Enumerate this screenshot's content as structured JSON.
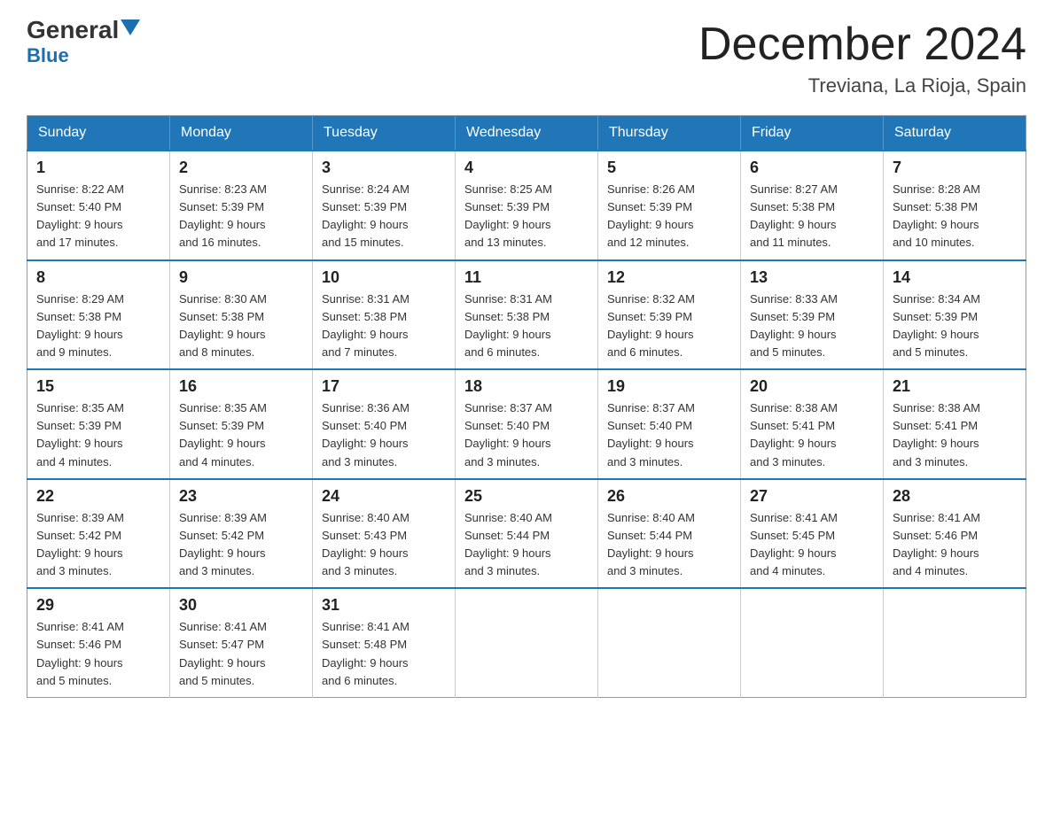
{
  "header": {
    "logo_general": "General",
    "logo_blue": "Blue",
    "title": "December 2024",
    "subtitle": "Treviana, La Rioja, Spain"
  },
  "days_of_week": [
    "Sunday",
    "Monday",
    "Tuesday",
    "Wednesday",
    "Thursday",
    "Friday",
    "Saturday"
  ],
  "weeks": [
    [
      {
        "day": "1",
        "info": "Sunrise: 8:22 AM\nSunset: 5:40 PM\nDaylight: 9 hours\nand 17 minutes."
      },
      {
        "day": "2",
        "info": "Sunrise: 8:23 AM\nSunset: 5:39 PM\nDaylight: 9 hours\nand 16 minutes."
      },
      {
        "day": "3",
        "info": "Sunrise: 8:24 AM\nSunset: 5:39 PM\nDaylight: 9 hours\nand 15 minutes."
      },
      {
        "day": "4",
        "info": "Sunrise: 8:25 AM\nSunset: 5:39 PM\nDaylight: 9 hours\nand 13 minutes."
      },
      {
        "day": "5",
        "info": "Sunrise: 8:26 AM\nSunset: 5:39 PM\nDaylight: 9 hours\nand 12 minutes."
      },
      {
        "day": "6",
        "info": "Sunrise: 8:27 AM\nSunset: 5:38 PM\nDaylight: 9 hours\nand 11 minutes."
      },
      {
        "day": "7",
        "info": "Sunrise: 8:28 AM\nSunset: 5:38 PM\nDaylight: 9 hours\nand 10 minutes."
      }
    ],
    [
      {
        "day": "8",
        "info": "Sunrise: 8:29 AM\nSunset: 5:38 PM\nDaylight: 9 hours\nand 9 minutes."
      },
      {
        "day": "9",
        "info": "Sunrise: 8:30 AM\nSunset: 5:38 PM\nDaylight: 9 hours\nand 8 minutes."
      },
      {
        "day": "10",
        "info": "Sunrise: 8:31 AM\nSunset: 5:38 PM\nDaylight: 9 hours\nand 7 minutes."
      },
      {
        "day": "11",
        "info": "Sunrise: 8:31 AM\nSunset: 5:38 PM\nDaylight: 9 hours\nand 6 minutes."
      },
      {
        "day": "12",
        "info": "Sunrise: 8:32 AM\nSunset: 5:39 PM\nDaylight: 9 hours\nand 6 minutes."
      },
      {
        "day": "13",
        "info": "Sunrise: 8:33 AM\nSunset: 5:39 PM\nDaylight: 9 hours\nand 5 minutes."
      },
      {
        "day": "14",
        "info": "Sunrise: 8:34 AM\nSunset: 5:39 PM\nDaylight: 9 hours\nand 5 minutes."
      }
    ],
    [
      {
        "day": "15",
        "info": "Sunrise: 8:35 AM\nSunset: 5:39 PM\nDaylight: 9 hours\nand 4 minutes."
      },
      {
        "day": "16",
        "info": "Sunrise: 8:35 AM\nSunset: 5:39 PM\nDaylight: 9 hours\nand 4 minutes."
      },
      {
        "day": "17",
        "info": "Sunrise: 8:36 AM\nSunset: 5:40 PM\nDaylight: 9 hours\nand 3 minutes."
      },
      {
        "day": "18",
        "info": "Sunrise: 8:37 AM\nSunset: 5:40 PM\nDaylight: 9 hours\nand 3 minutes."
      },
      {
        "day": "19",
        "info": "Sunrise: 8:37 AM\nSunset: 5:40 PM\nDaylight: 9 hours\nand 3 minutes."
      },
      {
        "day": "20",
        "info": "Sunrise: 8:38 AM\nSunset: 5:41 PM\nDaylight: 9 hours\nand 3 minutes."
      },
      {
        "day": "21",
        "info": "Sunrise: 8:38 AM\nSunset: 5:41 PM\nDaylight: 9 hours\nand 3 minutes."
      }
    ],
    [
      {
        "day": "22",
        "info": "Sunrise: 8:39 AM\nSunset: 5:42 PM\nDaylight: 9 hours\nand 3 minutes."
      },
      {
        "day": "23",
        "info": "Sunrise: 8:39 AM\nSunset: 5:42 PM\nDaylight: 9 hours\nand 3 minutes."
      },
      {
        "day": "24",
        "info": "Sunrise: 8:40 AM\nSunset: 5:43 PM\nDaylight: 9 hours\nand 3 minutes."
      },
      {
        "day": "25",
        "info": "Sunrise: 8:40 AM\nSunset: 5:44 PM\nDaylight: 9 hours\nand 3 minutes."
      },
      {
        "day": "26",
        "info": "Sunrise: 8:40 AM\nSunset: 5:44 PM\nDaylight: 9 hours\nand 3 minutes."
      },
      {
        "day": "27",
        "info": "Sunrise: 8:41 AM\nSunset: 5:45 PM\nDaylight: 9 hours\nand 4 minutes."
      },
      {
        "day": "28",
        "info": "Sunrise: 8:41 AM\nSunset: 5:46 PM\nDaylight: 9 hours\nand 4 minutes."
      }
    ],
    [
      {
        "day": "29",
        "info": "Sunrise: 8:41 AM\nSunset: 5:46 PM\nDaylight: 9 hours\nand 5 minutes."
      },
      {
        "day": "30",
        "info": "Sunrise: 8:41 AM\nSunset: 5:47 PM\nDaylight: 9 hours\nand 5 minutes."
      },
      {
        "day": "31",
        "info": "Sunrise: 8:41 AM\nSunset: 5:48 PM\nDaylight: 9 hours\nand 6 minutes."
      },
      {
        "day": "",
        "info": ""
      },
      {
        "day": "",
        "info": ""
      },
      {
        "day": "",
        "info": ""
      },
      {
        "day": "",
        "info": ""
      }
    ]
  ]
}
